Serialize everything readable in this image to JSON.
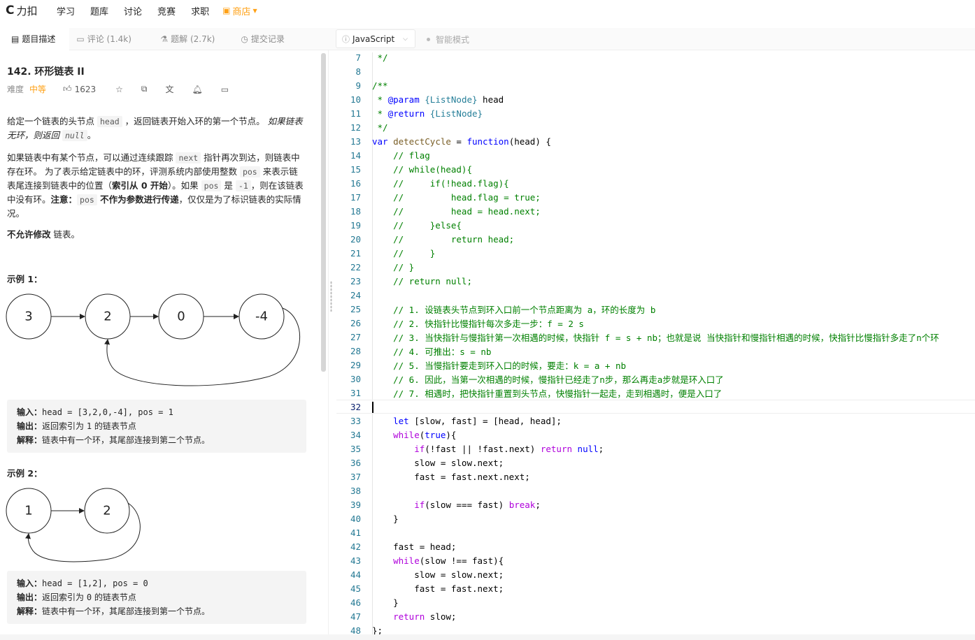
{
  "nav": {
    "logo_mark": "C",
    "logo_text": "力扣",
    "items": [
      "学习",
      "题库",
      "讨论",
      "竞赛",
      "求职"
    ],
    "shop": "商店"
  },
  "tabs": {
    "description": "题目描述",
    "comments": "评论 (1.4k)",
    "solutions": "题解 (2.7k)",
    "submissions": "提交记录",
    "language": "JavaScript",
    "smart_mode": "智能模式"
  },
  "problem": {
    "title": "142. 环形链表 II",
    "difficulty_label": "难度",
    "difficulty": "中等",
    "likes": "1623",
    "p1_a": "给定一个链表的头节点  ",
    "p1_code1": "head",
    "p1_b": " ，返回链表开始入环的第一个节点。 ",
    "p1_em": "如果链表无环，则返回 ",
    "p1_code2": "null",
    "p1_c": "。",
    "p2_a": "如果链表中有某个节点，可以通过连续跟踪 ",
    "p2_code1": "next",
    "p2_b": " 指针再次到达，则链表中存在环。 为了表示给定链表中的环，评测系统内部使用整数 ",
    "p2_code2": "pos",
    "p2_c": " 来表示链表尾连接到链表中的位置（",
    "p2_bold1": "索引从 0 开始",
    "p2_d": "）。如果 ",
    "p2_code3": "pos",
    "p2_e": " 是 ",
    "p2_code4": "-1",
    "p2_f": "，则在该链表中没有环。",
    "p2_bold2": "注意：",
    "p2_code5": "pos",
    "p2_bold3": " 不作为参数进行传递",
    "p2_g": "，仅仅是为了标识链表的实际情况。",
    "p3_bold": "不允许修改",
    "p3_rest": " 链表。"
  },
  "examples": [
    {
      "label": "示例 1：",
      "nodes": [
        "3",
        "2",
        "0",
        "-4"
      ],
      "input_label": "输入：",
      "input": "head = [3,2,0,-4], pos = 1",
      "output_label": "输出：",
      "output_a": "返回索引为 ",
      "output_code": "1",
      "output_b": " 的链表节点",
      "explain_label": "解释：",
      "explain": "链表中有一个环，其尾部连接到第二个节点。"
    },
    {
      "label": "示例 2：",
      "nodes": [
        "1",
        "2"
      ],
      "input_label": "输入：",
      "input": "head = [1,2], pos = 0",
      "output_label": "输出：",
      "output_a": "返回索引为 ",
      "output_code": "0",
      "output_b": " 的链表节点",
      "explain_label": "解释：",
      "explain": "链表中有一个环，其尾部连接到第一个节点。"
    }
  ],
  "editor": {
    "current_line": 32,
    "lines": [
      {
        "n": "7",
        "segs": [
          [
            " */",
            "c"
          ]
        ]
      },
      {
        "n": "8",
        "segs": []
      },
      {
        "n": "9",
        "segs": [
          [
            "/**",
            "c"
          ]
        ]
      },
      {
        "n": "10",
        "segs": [
          [
            " * ",
            "c"
          ],
          [
            "@param",
            "k"
          ],
          [
            " ",
            "c"
          ],
          [
            "{ListNode}",
            "t"
          ],
          [
            " head",
            ""
          ]
        ]
      },
      {
        "n": "11",
        "segs": [
          [
            " * ",
            "c"
          ],
          [
            "@return",
            "k"
          ],
          [
            " ",
            "c"
          ],
          [
            "{ListNode}",
            "t"
          ]
        ]
      },
      {
        "n": "12",
        "segs": [
          [
            " */",
            "c"
          ]
        ]
      },
      {
        "n": "13",
        "segs": [
          [
            "var",
            "k"
          ],
          [
            " ",
            ""
          ],
          [
            "detectCycle",
            "f"
          ],
          [
            " = ",
            ""
          ],
          [
            "function",
            "k"
          ],
          [
            "(head) {",
            ""
          ]
        ]
      },
      {
        "n": "14",
        "segs": [
          [
            "    // flag",
            "c"
          ]
        ]
      },
      {
        "n": "15",
        "segs": [
          [
            "    // while(head){",
            "c"
          ]
        ]
      },
      {
        "n": "16",
        "segs": [
          [
            "    //     if(!head.flag){",
            "c"
          ]
        ]
      },
      {
        "n": "17",
        "segs": [
          [
            "    //         head.flag = true;",
            "c"
          ]
        ]
      },
      {
        "n": "18",
        "segs": [
          [
            "    //         head = head.next;",
            "c"
          ]
        ]
      },
      {
        "n": "19",
        "segs": [
          [
            "    //     }else{",
            "c"
          ]
        ]
      },
      {
        "n": "20",
        "segs": [
          [
            "    //         return head;",
            "c"
          ]
        ]
      },
      {
        "n": "21",
        "segs": [
          [
            "    //     }",
            "c"
          ]
        ]
      },
      {
        "n": "22",
        "segs": [
          [
            "    // }",
            "c"
          ]
        ]
      },
      {
        "n": "23",
        "segs": [
          [
            "    // return null;",
            "c"
          ]
        ]
      },
      {
        "n": "24",
        "segs": []
      },
      {
        "n": "25",
        "segs": [
          [
            "    // 1. 设链表头节点到环入口前一个节点距离为 a，环的长度为 b",
            "c"
          ]
        ]
      },
      {
        "n": "26",
        "segs": [
          [
            "    // 2. 快指针比慢指针每次多走一步：f = 2 s",
            "c"
          ]
        ]
      },
      {
        "n": "27",
        "segs": [
          [
            "    // 3. 当快指针与慢指针第一次相遇的时候，快指针 f = s + nb；也就是说 当快指针和慢指针相遇的时候，快指针比慢指针多走了n个环",
            "c"
          ]
        ]
      },
      {
        "n": "28",
        "segs": [
          [
            "    // 4. 可推出：s = nb",
            "c"
          ]
        ]
      },
      {
        "n": "29",
        "segs": [
          [
            "    // 5. 当慢指针要走到环入口的时候，要走：k = a + nb",
            "c"
          ]
        ]
      },
      {
        "n": "30",
        "segs": [
          [
            "    // 6. 因此，当第一次相遇的时候，慢指针已经走了n步，那么再走a步就是环入口了",
            "c"
          ]
        ]
      },
      {
        "n": "31",
        "segs": [
          [
            "    // 7. 相遇时，把快指针重置到头节点，快慢指针一起走，走到相遇时，便是入口了",
            "c"
          ]
        ]
      },
      {
        "n": "32",
        "segs": []
      },
      {
        "n": "33",
        "segs": [
          [
            "    ",
            ""
          ],
          [
            "let",
            "k"
          ],
          [
            " [slow, fast] = [head, head];",
            ""
          ]
        ]
      },
      {
        "n": "34",
        "segs": [
          [
            "    ",
            ""
          ],
          [
            "while",
            "kc"
          ],
          [
            "(",
            ""
          ],
          [
            "true",
            "k"
          ],
          [
            "){",
            ""
          ]
        ]
      },
      {
        "n": "35",
        "segs": [
          [
            "        ",
            ""
          ],
          [
            "if",
            "kc"
          ],
          [
            "(!fast || !fast.next) ",
            ""
          ],
          [
            "return",
            "kc"
          ],
          [
            " ",
            ""
          ],
          [
            "null",
            "k"
          ],
          [
            ";",
            ""
          ]
        ]
      },
      {
        "n": "36",
        "segs": [
          [
            "        slow = slow.next;",
            ""
          ]
        ]
      },
      {
        "n": "37",
        "segs": [
          [
            "        fast = fast.next.next;",
            ""
          ]
        ]
      },
      {
        "n": "38",
        "segs": []
      },
      {
        "n": "39",
        "segs": [
          [
            "        ",
            ""
          ],
          [
            "if",
            "kc"
          ],
          [
            "(slow === fast) ",
            ""
          ],
          [
            "break",
            "kc"
          ],
          [
            ";",
            ""
          ]
        ]
      },
      {
        "n": "40",
        "segs": [
          [
            "    }",
            ""
          ]
        ]
      },
      {
        "n": "41",
        "segs": []
      },
      {
        "n": "42",
        "segs": [
          [
            "    fast = head;",
            ""
          ]
        ]
      },
      {
        "n": "43",
        "segs": [
          [
            "    ",
            ""
          ],
          [
            "while",
            "kc"
          ],
          [
            "(slow !== fast){",
            ""
          ]
        ]
      },
      {
        "n": "44",
        "segs": [
          [
            "        slow = slow.next;",
            ""
          ]
        ]
      },
      {
        "n": "45",
        "segs": [
          [
            "        fast = fast.next;",
            ""
          ]
        ]
      },
      {
        "n": "46",
        "segs": [
          [
            "    }",
            ""
          ]
        ]
      },
      {
        "n": "47",
        "segs": [
          [
            "    ",
            ""
          ],
          [
            "return",
            "kc"
          ],
          [
            " slow;",
            ""
          ]
        ]
      },
      {
        "n": "48",
        "segs": [
          [
            "};",
            ""
          ]
        ]
      }
    ]
  }
}
